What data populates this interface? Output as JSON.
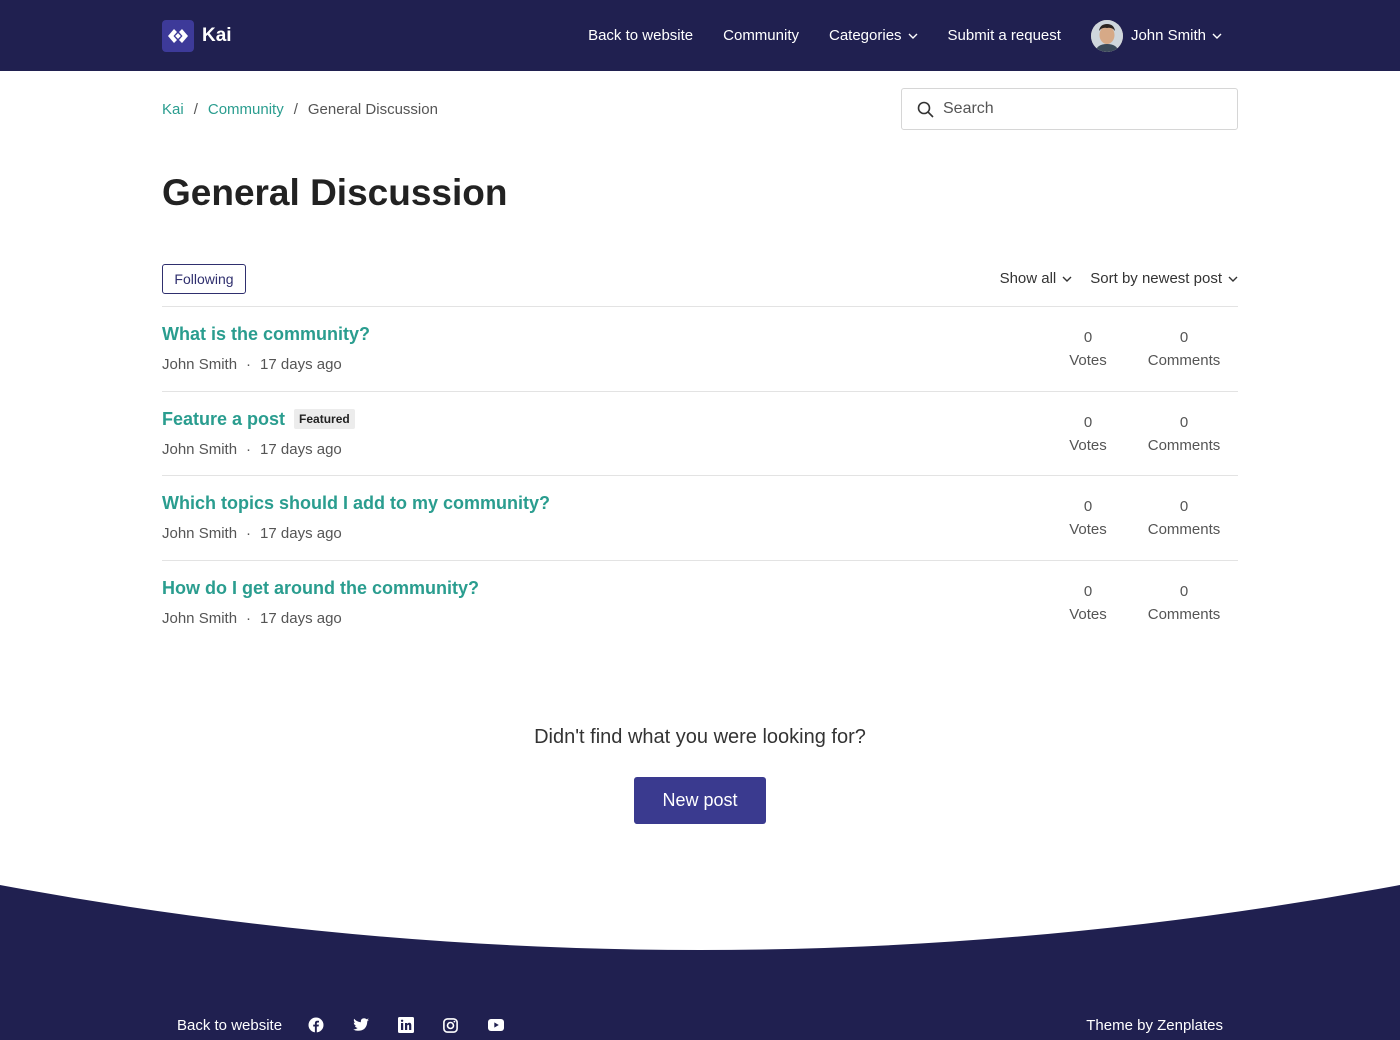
{
  "brand": {
    "name": "Kai"
  },
  "nav": {
    "items": [
      {
        "label": "Back to website"
      },
      {
        "label": "Community"
      },
      {
        "label": "Categories"
      },
      {
        "label": "Submit a request"
      }
    ],
    "user": {
      "name": "John Smith"
    }
  },
  "breadcrumb": {
    "items": [
      {
        "label": "Kai"
      },
      {
        "label": "Community"
      }
    ],
    "current": "General Discussion"
  },
  "search": {
    "placeholder": "Search",
    "value": ""
  },
  "page": {
    "title": "General Discussion"
  },
  "toolbar": {
    "following_label": "Following",
    "show_filter": "Show all",
    "sort_filter": "Sort by newest post"
  },
  "posts": [
    {
      "title": "What is the community?",
      "badge": "",
      "author": "John Smith",
      "time": "17 days ago",
      "votes": "0",
      "votes_label": "Votes",
      "comments": "0",
      "comments_label": "Comments"
    },
    {
      "title": "Feature a post",
      "badge": "Featured",
      "author": "John Smith",
      "time": "17 days ago",
      "votes": "0",
      "votes_label": "Votes",
      "comments": "0",
      "comments_label": "Comments"
    },
    {
      "title": "Which topics should I add to my community?",
      "badge": "",
      "author": "John Smith",
      "time": "17 days ago",
      "votes": "0",
      "votes_label": "Votes",
      "comments": "0",
      "comments_label": "Comments"
    },
    {
      "title": "How do I get around the community?",
      "badge": "",
      "author": "John Smith",
      "time": "17 days ago",
      "votes": "0",
      "votes_label": "Votes",
      "comments": "0",
      "comments_label": "Comments"
    }
  ],
  "cta": {
    "text": "Didn't find what you were looking for?",
    "button": "New post"
  },
  "footer": {
    "back_link": "Back to website",
    "social_icons": [
      "facebook-icon",
      "twitter-icon",
      "linkedin-icon",
      "instagram-icon",
      "youtube-icon"
    ],
    "credit": "Theme by Zenplates"
  },
  "colors": {
    "header_bg": "#202050",
    "accent": "#2a9d8f",
    "button": "#3a3a8f"
  }
}
